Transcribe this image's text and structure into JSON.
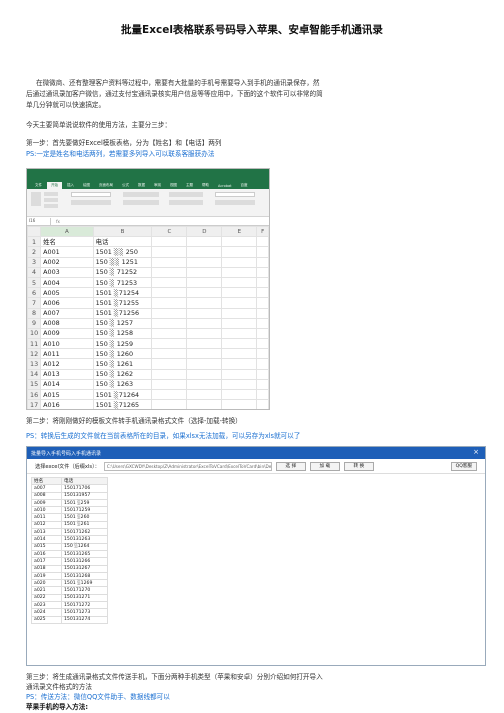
{
  "title": "批量Excel表格联系号码导入苹果、安卓智能手机通讯录",
  "intro": "在微微商、还有整理客户资料等过程中，需要有大批量的手机号需要导入到手机的通讯录保存，然后通过通讯录加客户微信，通过支付宝通讯录核实用户信息等等应用中，下面的这个软件可以非常的简单几分钟就可以快速搞定。",
  "intro_line1": "在微微商、还有整理客户资料等过程中，需要有大批量的手机号需要导入到手机的通讯录保存，然",
  "intro_line2": "后通过通讯录加客户微信，通过支付宝通讯录核实用户信息等等应用中，下面的这个软件可以非常的简",
  "intro_line3": "单几分钟就可以快速搞定。",
  "steps_intro": "今天主要简单说说软件的使用方法，主要分三步：",
  "step1": "第一步：首先要做好Excel模板表格，分为【姓名】和【电话】两列",
  "step1_ps": "PS:一定是姓名和电话两列，若需要多列导入可以联系客服获办法",
  "excel": {
    "tabs": [
      "文件",
      "开始",
      "插入",
      "绘图",
      "页面布局",
      "公式",
      "数据",
      "审阅",
      "视图",
      "主题",
      "帮助",
      "Acrobat",
      "百度",
      "Q",
      "操作说明"
    ],
    "active_tab": "开始",
    "name_box": "I16",
    "fx": "fx",
    "columns": [
      "A",
      "B",
      "C",
      "D",
      "E",
      "F"
    ],
    "rows": [
      [
        "1",
        "姓名",
        "电话"
      ],
      [
        "2",
        "A001",
        "1501 ░░ 250"
      ],
      [
        "3",
        "A002",
        "150 ░░ 1251"
      ],
      [
        "4",
        "A003",
        "150 ░ 71252"
      ],
      [
        "5",
        "A004",
        "150 ░ 71253"
      ],
      [
        "6",
        "A005",
        "1501 ░71254"
      ],
      [
        "7",
        "A006",
        "1501 ░71255"
      ],
      [
        "8",
        "A007",
        "1501 ░71256"
      ],
      [
        "9",
        "A008",
        "150 ░ 1257"
      ],
      [
        "10",
        "A009",
        "150 ░ 1258"
      ],
      [
        "11",
        "A010",
        "150 ░ 1259"
      ],
      [
        "12",
        "A011",
        "150 ░ 1260"
      ],
      [
        "13",
        "A012",
        "150 ░ 1261"
      ],
      [
        "14",
        "A013",
        "150 ░ 1262"
      ],
      [
        "15",
        "A014",
        "150 ░ 1263"
      ],
      [
        "16",
        "A015",
        "1501 ░71264"
      ],
      [
        "17",
        "A016",
        "1501 ░71265"
      ]
    ]
  },
  "step2": "第二步：将刚刚做好的模板文件转手机通讯录格式文件（选择-加载-转换）",
  "step2_ps": "PS：转换后生成的文件就在当前表格所在的目录，如果xlsx无法加载，可以另存为xls就可以了",
  "app": {
    "window_title": "批量导入手机号码入手机通讯录",
    "close": "×",
    "label": "选择excel文件（后缀xls）：",
    "path": "C:\\Users\\GXCWDY\\Desktop\\Z\\Administrator\\ExcelToVCard\\ExcelToVCard\\bin\\Debug\\批量导入.xls",
    "select": "选 择",
    "load": "加 载",
    "convert": "转 换",
    "qq": "QQ客服",
    "headers": [
      "姓名",
      "电话"
    ],
    "rows": [
      [
        "a007",
        "150171706"
      ],
      [
        "a008",
        "150131957"
      ],
      [
        "a009",
        "1501 ░259"
      ],
      [
        "a010",
        "150171259"
      ],
      [
        "a011",
        "1501 ░260"
      ],
      [
        "a012",
        "1501 ░261"
      ],
      [
        "a013",
        "150171262"
      ],
      [
        "a014",
        "150131263"
      ],
      [
        "a015",
        "150 ░1264"
      ],
      [
        "a016",
        "150131265"
      ],
      [
        "a017",
        "150131266"
      ],
      [
        "a018",
        "150131267"
      ],
      [
        "a019",
        "150131268"
      ],
      [
        "a020",
        "1501 ░1269"
      ],
      [
        "a021",
        "150171270"
      ],
      [
        "a022",
        "150131271"
      ],
      [
        "a023",
        "150171272"
      ],
      [
        "a024",
        "150171273"
      ],
      [
        "a025",
        "150131274"
      ]
    ]
  },
  "step3_line1": "第三步：将生成通讯录格式文件传送手机，下面分两种手机类型（苹果和安卓）分别介绍如何打开导入",
  "step3_line2": "通讯录文件格式的方法",
  "step3_ps": "PS：传送方法：微信QQ文件助手、数据线都可以",
  "apple_heading": "苹果手机的导入方法:"
}
